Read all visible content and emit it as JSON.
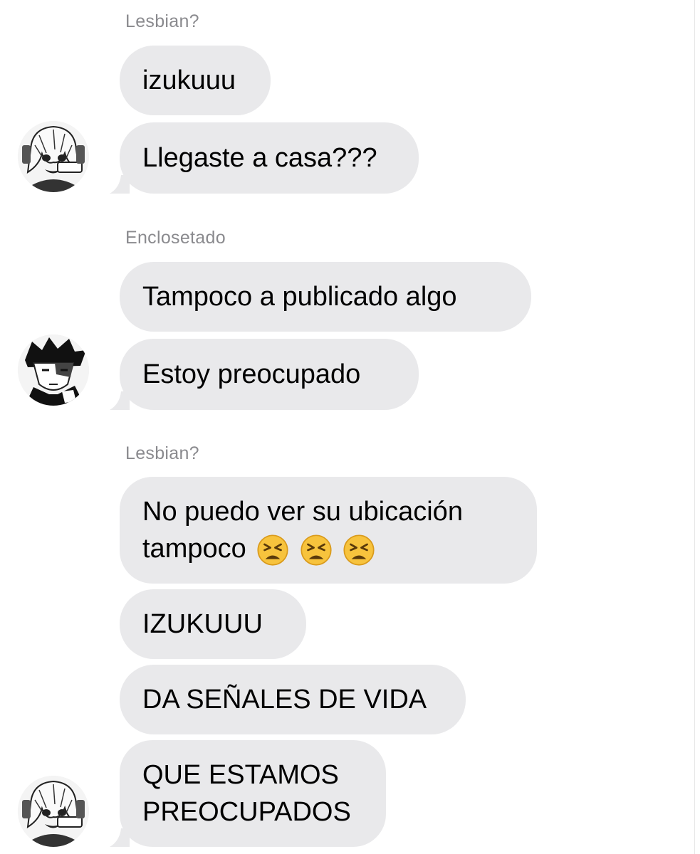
{
  "conversation": {
    "groups": [
      {
        "sender": "Lesbian?",
        "avatar_icon": "anime-girl-avatar-icon",
        "messages": [
          "izukuuu",
          "Llegaste a casa???"
        ]
      },
      {
        "sender": "Enclosetado",
        "avatar_icon": "anime-boy-avatar-icon",
        "messages": [
          "Tampoco a publicado algo",
          "Estoy preocupado"
        ]
      },
      {
        "sender": "Lesbian?",
        "avatar_icon": "anime-girl-avatar-icon",
        "messages": [
          {
            "line1": "No puedo ver su ubicación",
            "line2": "tampoco",
            "emoji": [
              "tired-face-emoji",
              "tired-face-emoji",
              "tired-face-emoji"
            ]
          },
          "IZUKUUU",
          "DA SEÑALES DE VIDA",
          {
            "line1": "QUE ESTAMOS",
            "line2": "PREOCUPADOS"
          }
        ]
      }
    ]
  },
  "colors": {
    "bubble_bg": "#e9e9eb",
    "sender_text": "#8a8a8e",
    "message_text": "#000000",
    "background": "#ffffff"
  }
}
